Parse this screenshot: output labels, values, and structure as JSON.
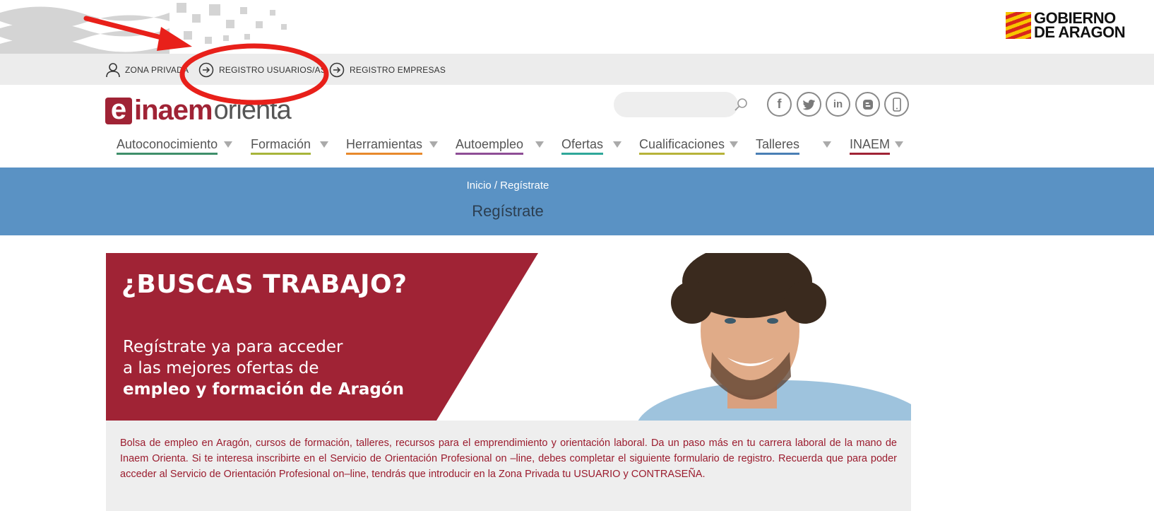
{
  "gov": {
    "line1": "GOBIERNO",
    "line2": "DE ARAGON"
  },
  "util": {
    "zona": "ZONA PRIVADA",
    "registro_usuarios": "REGISTRO USUARIOS/AS",
    "registro_empresas": "REGISTRO EMPRESAS"
  },
  "logo": {
    "mark": "e",
    "inaem": "inaem",
    "orienta": "orienta"
  },
  "search": {
    "value": "",
    "placeholder": ""
  },
  "social": {
    "facebook": "f",
    "twitter": "t",
    "linkedin": "in",
    "blogger": "b",
    "mobile": ""
  },
  "nav": [
    {
      "label": "Autoconocimiento",
      "color": "#3f8f6a"
    },
    {
      "label": "Formación",
      "color": "#a7b53a"
    },
    {
      "label": "Herramientas",
      "color": "#e8892c"
    },
    {
      "label": "Autoempleo",
      "color": "#8e4e96"
    },
    {
      "label": "Ofertas",
      "color": "#2fa89a"
    },
    {
      "label": "Cualificaciones",
      "color": "#b7b339"
    },
    {
      "label": "Talleres",
      "color": "#4a7fb5"
    },
    {
      "label": "INAEM",
      "color": "#a02335"
    }
  ],
  "breadcrumb": "Inicio / Regístrate",
  "page_title": "Regístrate",
  "hero": {
    "title": "¿BUSCAS TRABAJO?",
    "line1": "Regístrate ya para acceder",
    "line2": "a las mejores ofertas de",
    "line3": "empleo y formación de Aragón"
  },
  "description": "Bolsa de empleo en Aragón, cursos de formación, talleres, recursos para el emprendimiento y orientación laboral. Da un paso más en tu carrera laboral de la mano de Inaem Orienta. Si te interesa inscribirte en el Servicio de Orientación Profesional on –line, debes completar el siguiente formulario de registro. Recuerda que para poder acceder al Servicio de Orientación Profesional on–line, tendrás que introducir en la Zona Privada tu USUARIO y CONTRASEÑA.",
  "colors": {
    "brand": "#a02335",
    "band": "#5a92c4",
    "annotation": "#e8201a"
  },
  "icons": {
    "user": "user-icon",
    "login": "arrow-circle-icon",
    "search": "search-icon",
    "facebook": "facebook-icon",
    "twitter": "twitter-icon",
    "linkedin": "linkedin-icon",
    "blogger": "blogger-icon",
    "mobile": "mobile-icon"
  }
}
